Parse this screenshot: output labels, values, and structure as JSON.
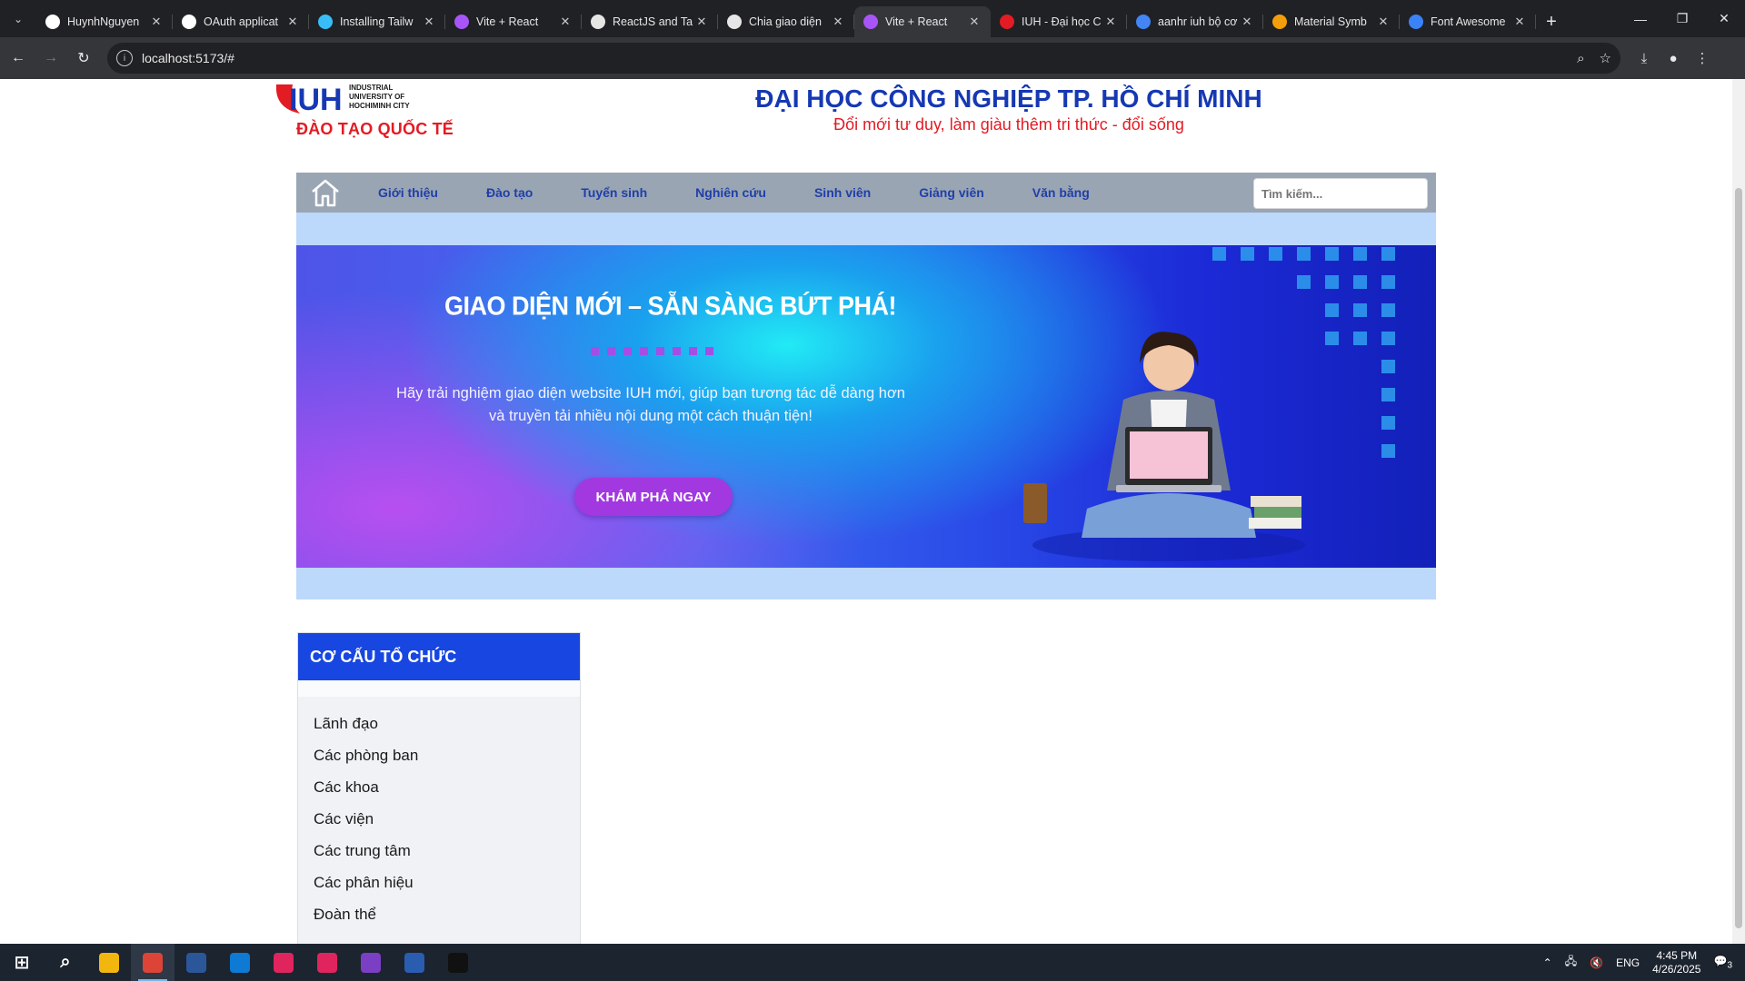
{
  "browser": {
    "tabs": [
      {
        "title": "HuynhNguyen",
        "favicon": "github-icon",
        "active": false
      },
      {
        "title": "OAuth applicat",
        "favicon": "github-icon",
        "active": false
      },
      {
        "title": "Installing Tailw",
        "favicon": "tailwind-icon",
        "active": false
      },
      {
        "title": "Vite + React",
        "favicon": "vite-icon",
        "active": false
      },
      {
        "title": "ReactJS and Ta",
        "favicon": "sync-icon",
        "active": false
      },
      {
        "title": "Chia giao diện",
        "favicon": "chatgpt-icon",
        "active": false
      },
      {
        "title": "Vite + React",
        "favicon": "vite-icon",
        "active": true
      },
      {
        "title": "IUH - Đại học C",
        "favicon": "iuh-icon",
        "active": false
      },
      {
        "title": "aanhr iuh bộ cơ",
        "favicon": "google-icon",
        "active": false
      },
      {
        "title": "Material Symb",
        "favicon": "material-icon",
        "active": false
      },
      {
        "title": "Font Awesome",
        "favicon": "fontawesome-icon",
        "active": false
      }
    ],
    "address": "localhost:5173/#"
  },
  "header": {
    "logo_lines": [
      "INDUSTRIAL",
      "UNIVERSITY OF",
      "HOCHIMINH CITY"
    ],
    "logo_mark": "IUH",
    "logo_tagline": "ĐÀO TẠO QUỐC TẾ",
    "title": "ĐẠI HỌC CÔNG NGHIỆP TP. HỒ CHÍ MINH",
    "slogan": "Đổi mới tư duy, làm giàu thêm tri thức - đổi sống"
  },
  "menu": {
    "items": [
      "Giới thiệu",
      "Đào tạo",
      "Tuyển sinh",
      "Nghiên cứu",
      "Sinh viên",
      "Giảng viên",
      "Văn bằng"
    ],
    "search_placeholder": "Tìm kiếm..."
  },
  "banner": {
    "headline": "GIAO DIỆN MỚI – SẴN SÀNG BỨT PHÁ!",
    "description": "Hãy trải nghiệm giao diện website IUH mới, giúp bạn tương tác dễ dàng hơn và truyền tải nhiều nội dung một cách thuận tiện!",
    "cta": "KHÁM PHÁ NGAY"
  },
  "sidebar": {
    "title": "CƠ CẤU TỔ CHỨC",
    "items": [
      "Lãnh đạo",
      "Các phòng ban",
      "Các khoa",
      "Các viện",
      "Các trung tâm",
      "Các phân hiệu",
      "Đoàn thể"
    ]
  },
  "taskbar": {
    "apps": [
      "windows-start-icon",
      "search-icon",
      "file-explorer-icon",
      "chrome-icon",
      "word-icon",
      "vscode-icon",
      "app-icon",
      "app-icon",
      "visual-studio-icon",
      "powershell-icon",
      "terminal-icon"
    ],
    "language": "ENG",
    "time": "4:45 PM",
    "date": "4/26/2025",
    "notifications": "3"
  },
  "colors": {
    "brand_blue": "#1638b3",
    "brand_red": "#e31b23",
    "menu_bar": "#9aa5b4",
    "banner_bg": "#bcd8fb",
    "panel_header": "#1746e0",
    "cta": "#a238e0"
  }
}
